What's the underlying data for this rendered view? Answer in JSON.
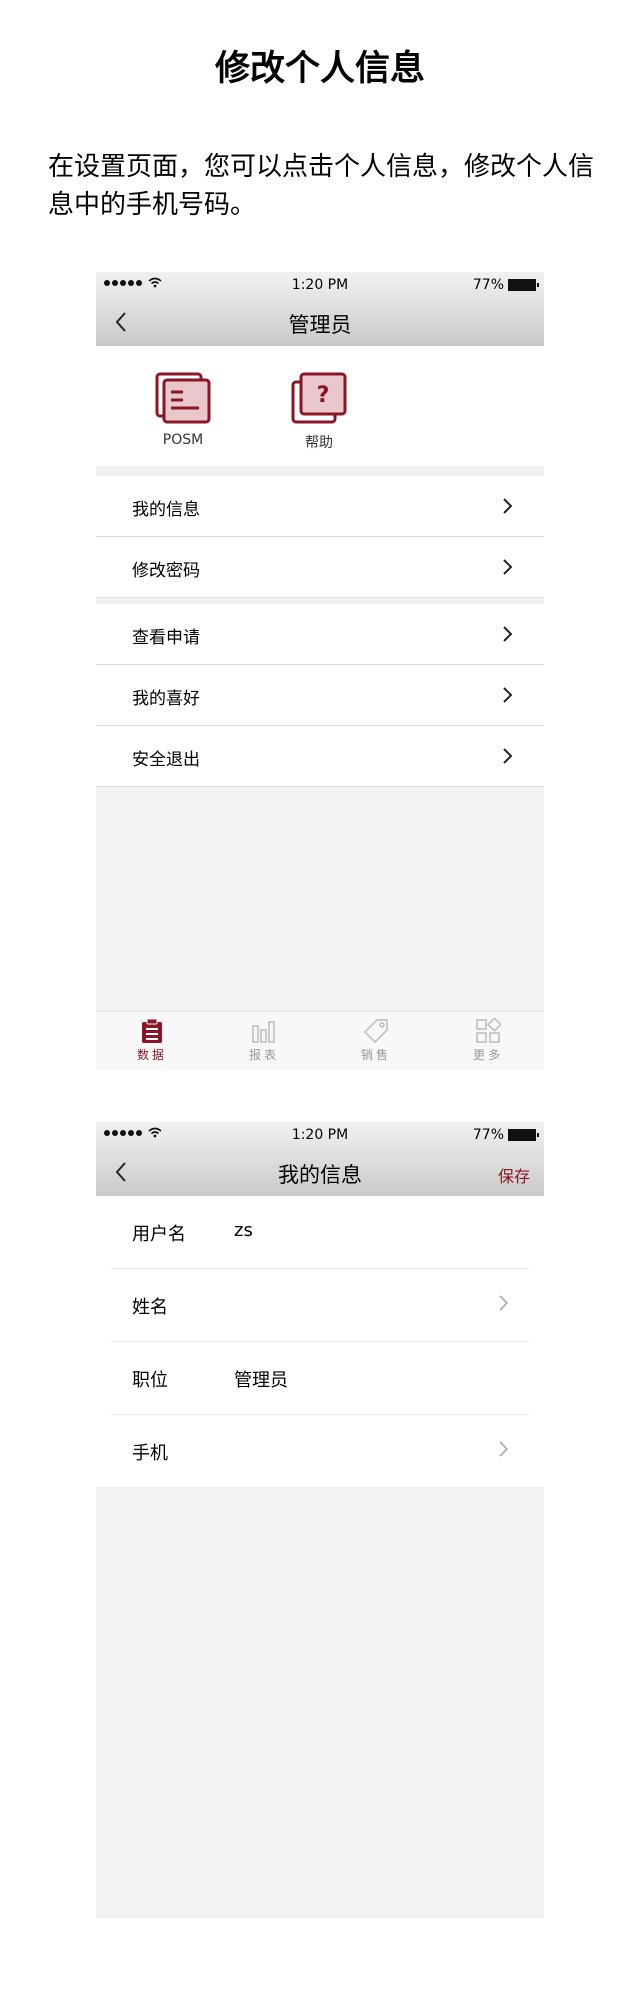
{
  "page": {
    "title": "修改个人信息",
    "intro": "在设置页面，您可以点击个人信息，修改个人信息中的手机号码。"
  },
  "status_bar": {
    "time": "1:20 PM",
    "battery": "77%"
  },
  "screen1": {
    "nav_title": "管理员",
    "quick_actions": [
      {
        "label": "POSM",
        "icon": "posm-icon"
      },
      {
        "label": "帮助",
        "icon": "help-icon"
      }
    ],
    "menu_group1": [
      {
        "label": "我的信息"
      },
      {
        "label": "修改密码"
      }
    ],
    "menu_group2": [
      {
        "label": "查看申请"
      },
      {
        "label": "我的喜好"
      },
      {
        "label": "安全退出"
      }
    ],
    "tabs": [
      {
        "label": "数据",
        "icon": "clipboard-icon",
        "active": true
      },
      {
        "label": "报表",
        "icon": "bar-chart-icon",
        "active": false
      },
      {
        "label": "销售",
        "icon": "price-tag-icon",
        "active": false
      },
      {
        "label": "更多",
        "icon": "grid-icon",
        "active": false
      }
    ]
  },
  "screen2": {
    "nav_title": "我的信息",
    "save_label": "保存",
    "fields": [
      {
        "label": "用户名",
        "value": "zs"
      },
      {
        "label": "姓名",
        "value": ""
      },
      {
        "label": "职位",
        "value": "管理员"
      },
      {
        "label": "手机",
        "value": ""
      }
    ]
  },
  "colors": {
    "accent": "#8a1525",
    "accent_light": "#e8c8cc",
    "background": "#f2f2f2",
    "tab_inactive": "#999999"
  }
}
